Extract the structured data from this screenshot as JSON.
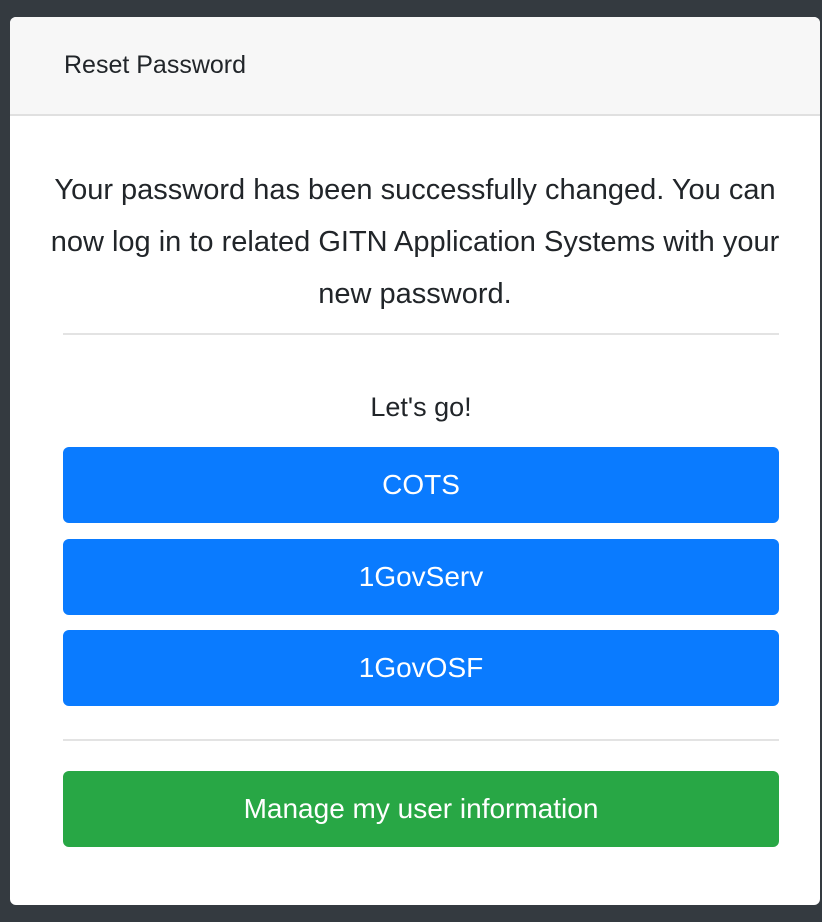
{
  "card": {
    "header_title": "Reset Password",
    "message": "Your password has been successfully changed. You can now log in to related GITN Application Systems with your new password.",
    "lets_go": "Let's go!",
    "app_buttons": [
      "COTS",
      "1GovServ",
      "1GovOSF"
    ],
    "manage_button": "Manage my user information"
  },
  "colors": {
    "primary": "#0a7bff",
    "success": "#28a745",
    "header_bg": "#f7f7f7",
    "page_bg": "#343a40"
  }
}
